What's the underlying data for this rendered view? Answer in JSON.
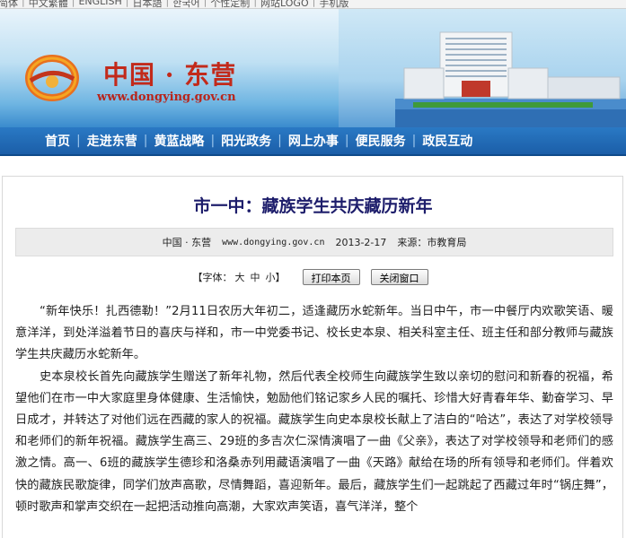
{
  "topbar": {
    "links": [
      "简体",
      "中文繁體",
      "ENGLISH",
      "日本語",
      "한국어",
      "个性定制",
      "网站LOGO",
      "手机版"
    ]
  },
  "header": {
    "site_name": "中国 · 东营",
    "site_url": "www.dongying.gov.cn"
  },
  "nav": {
    "items": [
      "首页",
      "走进东营",
      "黄蓝战略",
      "阳光政务",
      "网上办事",
      "便民服务",
      "政民互动"
    ]
  },
  "article": {
    "title": "市一中：藏族学生共庆藏历新年",
    "meta": {
      "source_site": "中国 · 东营",
      "url": "www.dongying.gov.cn",
      "date": "2013-2-17",
      "source": "来源：市教育局"
    },
    "font_size": {
      "label": "【字体：",
      "large": "大",
      "medium": "中",
      "small": "小】"
    },
    "print_button": "打印本页",
    "close_button": "关闭窗口",
    "paragraphs": [
      "“新年快乐！扎西德勒！”2月11日农历大年初二，适逢藏历水蛇新年。当日中午，市一中餐厅内欢歌笑语、暖意洋洋，到处洋溢着节日的喜庆与祥和，市一中党委书记、校长史本泉、相关科室主任、班主任和部分教师与藏族学生共庆藏历水蛇新年。",
      "史本泉校长首先向藏族学生赠送了新年礼物，然后代表全校师生向藏族学生致以亲切的慰问和新春的祝福，希望他们在市一中大家庭里身体健康、生活愉快，勉励他们铭记家乡人民的嘱托、珍惜大好青春年华、勤奋学习、早日成才，并转达了对他们远在西藏的家人的祝福。藏族学生向史本泉校长献上了洁白的“哈达”，表达了对学校领导和老师们的新年祝福。藏族学生高三、29班的多吉次仁深情演唱了一曲《父亲》，表达了对学校领导和老师们的感激之情。高一、6班的藏族学生德珍和洛桑赤列用藏语演唱了一曲《天路》献给在场的所有领导和老师们。伴着欢快的藏族民歌旋律，同学们放声高歌，尽情舞蹈，喜迎新年。最后，藏族学生们一起跳起了西藏过年时“锅庄舞”，顿时歌声和掌声交织在一起把活动推向高潮，大家欢声笑语，喜气洋洋，整个"
    ]
  }
}
